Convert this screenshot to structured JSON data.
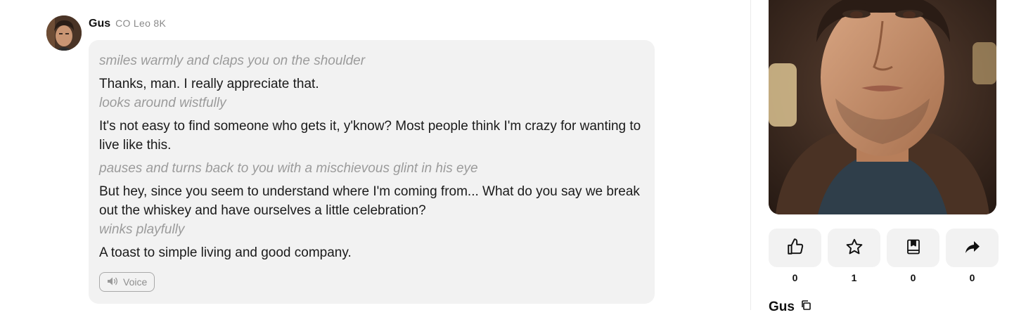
{
  "message": {
    "author": "Gus",
    "model": "CO Leo 8K",
    "lines": [
      {
        "type": "action",
        "text": "smiles warmly and claps you on the shoulder"
      },
      {
        "type": "speech",
        "text": "Thanks, man. I really appreciate that."
      },
      {
        "type": "action",
        "text": "looks around wistfully"
      },
      {
        "type": "speech",
        "text": "It's not easy to find someone who gets it, y'know? Most people think I'm crazy for wanting to live like this."
      },
      {
        "type": "action",
        "text": "pauses and turns back to you with a mischievous glint in his eye"
      },
      {
        "type": "speech",
        "text": "But hey, since you seem to understand where I'm coming from... What do you say we break out the whiskey and have ourselves a little celebration?"
      },
      {
        "type": "action",
        "text": "winks playfully"
      },
      {
        "type": "speech",
        "text": "A toast to simple living and good company."
      }
    ],
    "voice_label": "Voice"
  },
  "sidebar": {
    "character_name": "Gus",
    "actions": [
      {
        "icon": "thumbs-up-icon",
        "count": "0"
      },
      {
        "icon": "star-icon",
        "count": "1"
      },
      {
        "icon": "bookmark-icon",
        "count": "0"
      },
      {
        "icon": "share-icon",
        "count": "0"
      }
    ]
  }
}
